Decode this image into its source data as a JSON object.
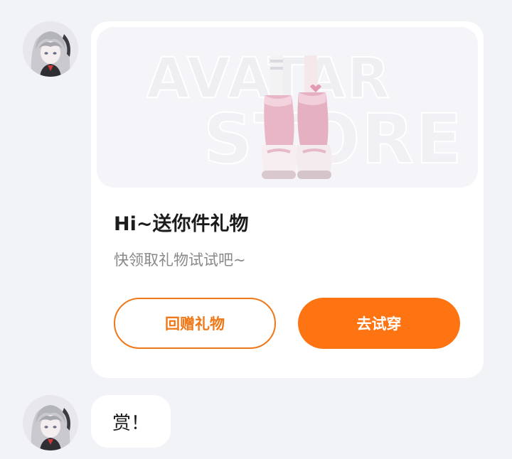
{
  "messages": [
    {
      "type": "gift-card",
      "avatar_icon": "anime-girl-avatar-icon",
      "banner": {
        "image_icon": "pink-boots-icon",
        "watermark_line1": "AVATAR",
        "watermark_line2": "STORE"
      },
      "title": "Hi~送你件礼物",
      "subtitle": "快领取礼物试试吧~",
      "buttons": {
        "return_gift": "回赠礼物",
        "try_on": "去试穿"
      }
    },
    {
      "type": "text",
      "avatar_icon": "anime-girl-avatar-icon",
      "text": "赏！"
    }
  ],
  "colors": {
    "accent": "#ff7412",
    "outline": "#f07818",
    "background": "#f2f3f7",
    "card": "#ffffff"
  }
}
